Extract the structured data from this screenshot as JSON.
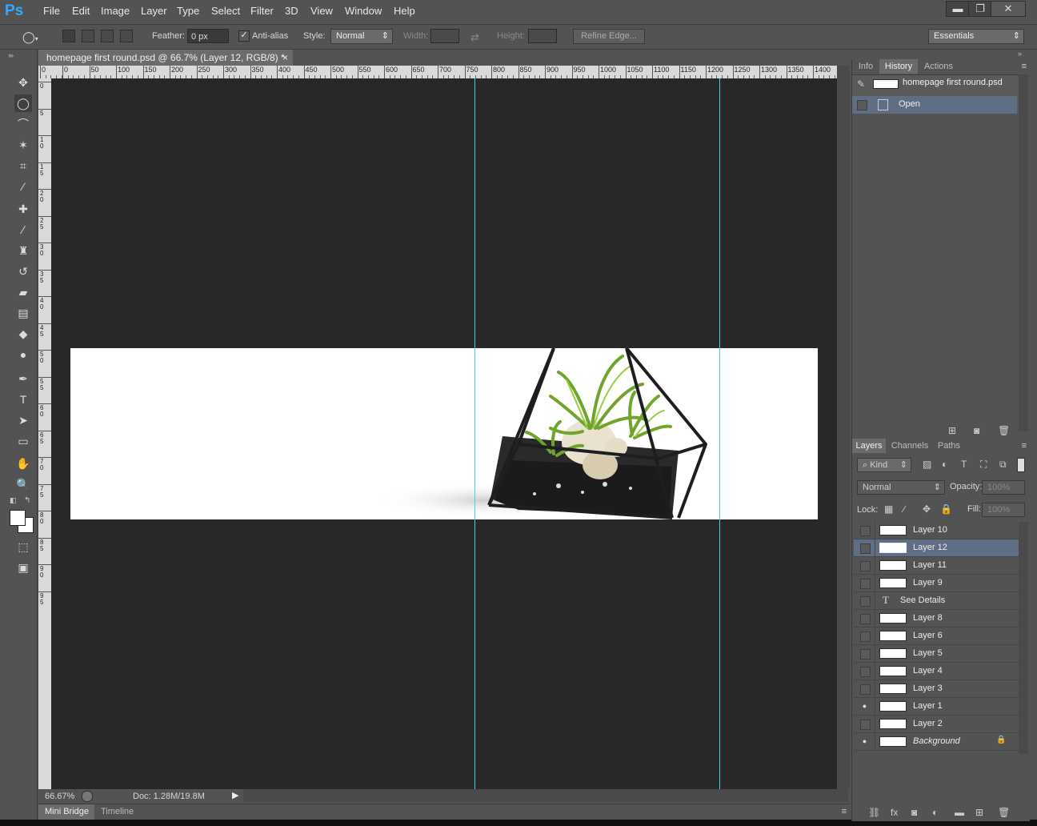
{
  "app": {
    "logo": "Ps",
    "brand_color": "#31a8ff"
  },
  "menu": [
    "File",
    "Edit",
    "Image",
    "Layer",
    "Type",
    "Select",
    "Filter",
    "3D",
    "View",
    "Window",
    "Help"
  ],
  "window_controls": {
    "minimize": "▬",
    "restore": "❐",
    "close": "✕"
  },
  "options": {
    "feather_label": "Feather:",
    "feather_value": "0 px",
    "antialias_label": "Anti-alias",
    "antialias_checked": true,
    "style_label": "Style:",
    "style_value": "Normal",
    "width_label": "Width:",
    "height_label": "Height:",
    "refine_edge": "Refine Edge...",
    "workspace": "Essentials"
  },
  "document": {
    "tab_title": "homepage first round.psd @ 66.7% (Layer 12, RGB/8) *",
    "close": "×",
    "zoom": "66.67%",
    "doc_size": "Doc: 1.28M/19.8M",
    "guide_color": "#3fd4e4",
    "ruler_h_ticks": [
      "0",
      "0",
      "50",
      "100",
      "150",
      "200",
      "250",
      "300",
      "350",
      "400",
      "450",
      "500",
      "550",
      "600",
      "650",
      "700",
      "750",
      "800",
      "850",
      "900",
      "950",
      "1000",
      "1050",
      "1100",
      "1150",
      "1200",
      "1250",
      "1300",
      "1350",
      "1400"
    ],
    "ruler_v_ticks": [
      "0",
      "5",
      "1\n0",
      "1\n5",
      "2\n0",
      "2\n5",
      "3\n0",
      "3\n5",
      "4\n0",
      "4\n5",
      "5\n0",
      "5\n5",
      "6\n0",
      "6\n5",
      "7\n0",
      "7\n5",
      "8\n0",
      "8\n5",
      "9\n0",
      "9\n5"
    ]
  },
  "history_panel": {
    "tabs": [
      "Info",
      "History",
      "Actions"
    ],
    "active_tab": "History",
    "snapshot": "homepage first round.psd",
    "states": [
      "Open"
    ]
  },
  "layers_panel": {
    "tabs": [
      "Layers",
      "Channels",
      "Paths"
    ],
    "active_tab": "Layers",
    "filter_kind": "Kind",
    "blend_mode": "Normal",
    "opacity_label": "Opacity:",
    "opacity_value": "100%",
    "lock_label": "Lock:",
    "fill_label": "Fill:",
    "fill_value": "100%",
    "layers": [
      {
        "name": "Layer 10",
        "visible": false,
        "selected": false,
        "type": "pixel"
      },
      {
        "name": "Layer 12",
        "visible": false,
        "selected": true,
        "type": "pixel"
      },
      {
        "name": "Layer 11",
        "visible": false,
        "selected": false,
        "type": "pixel"
      },
      {
        "name": "Layer 9",
        "visible": false,
        "selected": false,
        "type": "pixel"
      },
      {
        "name": "See Details",
        "visible": false,
        "selected": false,
        "type": "text"
      },
      {
        "name": "Layer 8",
        "visible": false,
        "selected": false,
        "type": "pixel"
      },
      {
        "name": "Layer 6",
        "visible": false,
        "selected": false,
        "type": "pixel"
      },
      {
        "name": "Layer 5",
        "visible": false,
        "selected": false,
        "type": "pixel"
      },
      {
        "name": "Layer 4",
        "visible": false,
        "selected": false,
        "type": "pixel"
      },
      {
        "name": "Layer 3",
        "visible": false,
        "selected": false,
        "type": "pixel"
      },
      {
        "name": "Layer 1",
        "visible": true,
        "selected": false,
        "type": "pixel"
      },
      {
        "name": "Layer 2",
        "visible": false,
        "selected": false,
        "type": "pixel"
      },
      {
        "name": "Background",
        "visible": true,
        "selected": false,
        "type": "background",
        "locked": true
      }
    ]
  },
  "bottom_tabs": [
    "Mini Bridge",
    "Timeline"
  ],
  "tools": [
    "move-tool",
    "elliptical-marquee-tool",
    "lasso-tool",
    "magic-wand-tool",
    "crop-tool",
    "eyedropper-tool",
    "spot-healing-tool",
    "brush-tool",
    "clone-stamp-tool",
    "history-brush-tool",
    "eraser-tool",
    "gradient-tool",
    "blur-tool",
    "dodge-tool",
    "pen-tool",
    "type-tool",
    "path-selection-tool",
    "shape-tool",
    "hand-tool",
    "zoom-tool"
  ]
}
